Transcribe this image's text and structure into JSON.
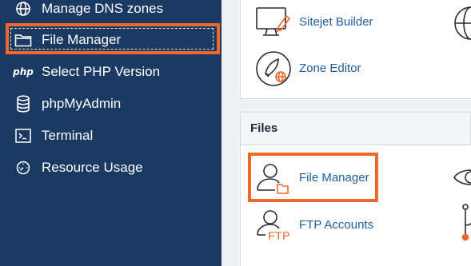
{
  "sidebar": {
    "items": [
      {
        "label": "Manage DNS zones",
        "icon": "globe-icon"
      },
      {
        "label": "File Manager",
        "icon": "folder-icon"
      },
      {
        "label": "Select PHP Version",
        "icon": "php-icon",
        "icon_text": "php"
      },
      {
        "label": "phpMyAdmin",
        "icon": "database-icon"
      },
      {
        "label": "Terminal",
        "icon": "terminal-icon"
      },
      {
        "label": "Resource Usage",
        "icon": "gauge-icon"
      }
    ]
  },
  "domains_section": {
    "tools": [
      {
        "label": "Sitejet Builder",
        "icon": "sitejet-monitor-icon"
      },
      {
        "label": "Zone Editor",
        "icon": "zone-editor-icon"
      }
    ]
  },
  "files_section": {
    "title": "Files",
    "tools": [
      {
        "label": "File Manager",
        "icon": "file-manager-user-icon"
      },
      {
        "label": "FTP Accounts",
        "icon": "ftp-user-icon",
        "icon_text": "FTP"
      }
    ]
  },
  "colors": {
    "sidebar_bg": "#1b3a63",
    "highlight": "#f0662b",
    "link": "#1f5e9e",
    "icon_accent": "#f0662b"
  }
}
